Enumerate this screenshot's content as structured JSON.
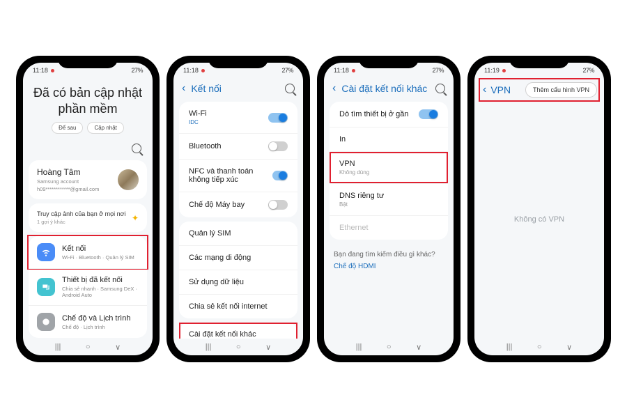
{
  "status": {
    "time_a": "11:18",
    "time_b": "11:19",
    "battery": "27%"
  },
  "nav": {
    "recent": "|||",
    "home": "○",
    "back": "∨"
  },
  "p1": {
    "headline_l1": "Đã có bản cập nhật",
    "headline_l2": "phần mềm",
    "btn_later": "Để sau",
    "btn_update": "Cập nhật",
    "account": {
      "name": "Hoàng Tâm",
      "sub1": "Samsung account",
      "sub2": "h09************@gmail.com"
    },
    "hint": {
      "title": "Truy cập ảnh của bạn ở mọi nơi",
      "sub": "1 gợi ý khác"
    },
    "rows": {
      "connections": {
        "title": "Kết nối",
        "sub": "Wi-Fi · Bluetooth · Quản lý SIM"
      },
      "connected": {
        "title": "Thiết bị đã kết nối",
        "sub": "Chia sẻ nhanh · Samsung DeX · Android Auto"
      },
      "modes": {
        "title": "Chế độ và Lịch trình",
        "sub": "Chế độ · Lịch trình"
      }
    }
  },
  "p2": {
    "title": "Kết nối",
    "wifi": {
      "label": "Wi-Fi",
      "sub": "IDC"
    },
    "bluetooth": "Bluetooth",
    "nfc": "NFC và thanh toán không tiếp xúc",
    "airplane": "Chế độ Máy bay",
    "sim": "Quản lý SIM",
    "mobile": "Các mạng di động",
    "data": "Sử dụng dữ liệu",
    "hotspot": "Chia sẻ kết nối internet",
    "more": "Cài đặt kết nối khác"
  },
  "p3": {
    "title": "Cài đặt kết nối khác",
    "nearby": "Dò tìm thiết bị ở gần",
    "print": "In",
    "vpn": {
      "label": "VPN",
      "sub": "Không dùng"
    },
    "dns": {
      "label": "DNS riêng tư",
      "sub": "Bật"
    },
    "eth": "Ethernet",
    "more_q": "Bạn đang tìm kiếm điều gì khác?",
    "hdmi": "Chế độ HDMI"
  },
  "p4": {
    "title": "VPN",
    "add": "Thêm cấu hình VPN",
    "empty": "Không có VPN"
  }
}
